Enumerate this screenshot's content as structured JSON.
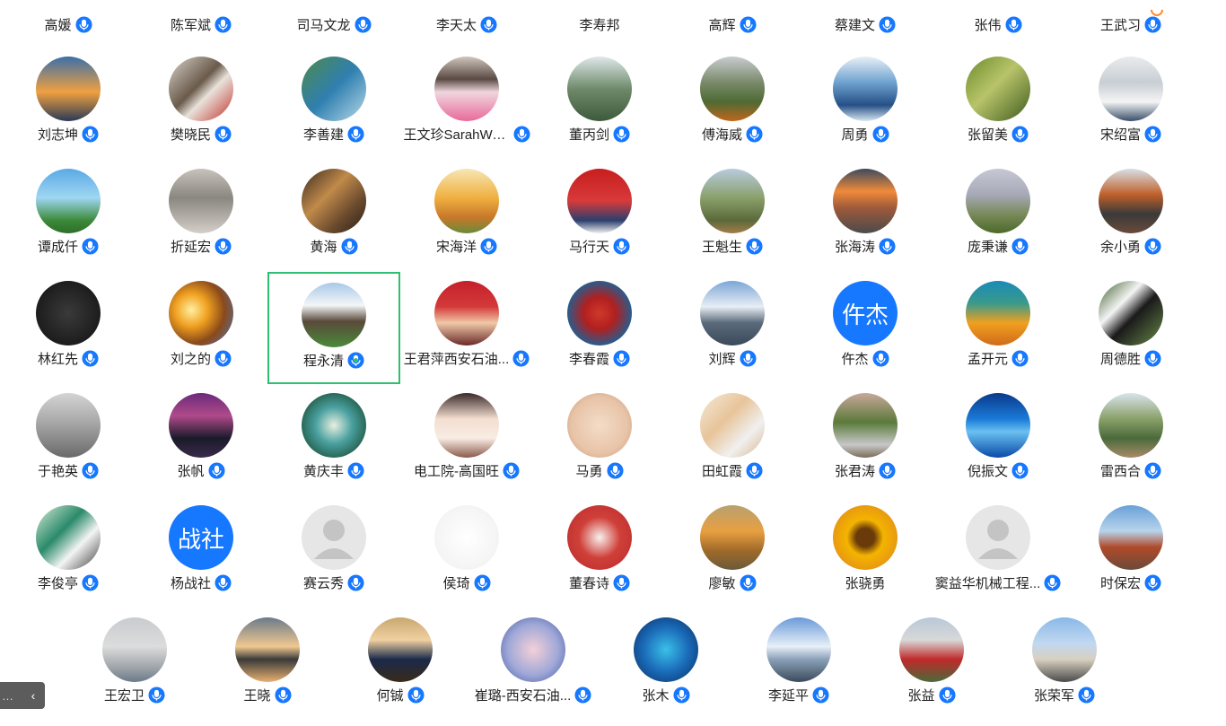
{
  "rows": [
    {
      "kind": "top",
      "participants": [
        {
          "name": "高媛",
          "mic": "on",
          "avatar": {
            "type": "none"
          }
        },
        {
          "name": "陈军斌",
          "mic": "on",
          "avatar": {
            "type": "none"
          }
        },
        {
          "name": "司马文龙",
          "mic": "on",
          "avatar": {
            "type": "none"
          }
        },
        {
          "name": "李天太",
          "mic": "on",
          "avatar": {
            "type": "none"
          }
        },
        {
          "name": "李寿邦",
          "mic": "none",
          "avatar": {
            "type": "none"
          }
        },
        {
          "name": "高辉",
          "mic": "on",
          "avatar": {
            "type": "none"
          }
        },
        {
          "name": "蔡建文",
          "mic": "on",
          "avatar": {
            "type": "none"
          }
        },
        {
          "name": "张伟",
          "mic": "on",
          "avatar": {
            "type": "none"
          }
        },
        {
          "name": "王武习",
          "mic": "on",
          "avatar": {
            "type": "none"
          }
        }
      ]
    },
    {
      "kind": "full",
      "participants": [
        {
          "name": "刘志坤",
          "mic": "on",
          "avatar": {
            "type": "photo",
            "bg": "linear-gradient(180deg,#3b6fa8 0%,#f0a040 55%,#2a3a55 100%)",
            "icon": "sunset-bridge-photo"
          }
        },
        {
          "name": "樊晓民",
          "mic": "on",
          "avatar": {
            "type": "photo",
            "bg": "linear-gradient(135deg,#d9d4cc 0%,#6a5a4a 45%,#e8e2da 60%,#c0302a 100%)",
            "icon": "eagle-photo"
          }
        },
        {
          "name": "李善建",
          "mic": "on",
          "avatar": {
            "type": "photo",
            "bg": "linear-gradient(135deg,#4d8a4a 0%,#2f7fb0 50%,#b9d9e8 100%)",
            "icon": "coastline-photo"
          }
        },
        {
          "name": "王文珍SarahWe...",
          "mic": "on",
          "avatar": {
            "type": "photo",
            "bg": "linear-gradient(180deg,#cfc6bd 0%,#5a4a44 35%,#f0d6de 55%,#e86a9a 100%)",
            "icon": "woman-with-flowers-photo"
          }
        },
        {
          "name": "董丙剑",
          "mic": "on",
          "avatar": {
            "type": "photo",
            "bg": "linear-gradient(180deg,#dfe8ea 0%,#6e8a6a 50%,#3e5a3c 100%)",
            "icon": "mountain-pine-photo"
          }
        },
        {
          "name": "傅海威",
          "mic": "on",
          "avatar": {
            "type": "photo",
            "bg": "linear-gradient(180deg,#c8ccd0 0%,#7a8a6a 40%,#4e6a34 70%,#c0661c 100%)",
            "icon": "orchard-photo"
          }
        },
        {
          "name": "周勇",
          "mic": "on",
          "avatar": {
            "type": "photo",
            "bg": "linear-gradient(180deg,#e8f0f6 0%,#6fa2d0 40%,#254f86 75%,#d8e6f0 100%)",
            "icon": "ferris-wheel-photo"
          }
        },
        {
          "name": "张留美",
          "mic": "on",
          "avatar": {
            "type": "photo",
            "bg": "linear-gradient(135deg,#6b8a2a 0%,#b8c46a 45%,#3f5a1e 100%)",
            "icon": "bamboo-photo"
          }
        },
        {
          "name": "宋绍富",
          "mic": "on",
          "avatar": {
            "type": "photo",
            "bg": "linear-gradient(180deg,#e9ecee 0%,#c8ced4 40%,#f4f4f4 70%,#3a4e6a 100%)",
            "icon": "man-portrait-photo"
          }
        }
      ]
    },
    {
      "kind": "full",
      "participants": [
        {
          "name": "谭成仟",
          "mic": "on",
          "avatar": {
            "type": "photo",
            "bg": "linear-gradient(180deg,#5aa9e6 0%,#9fd6f2 45%,#3c8a3a 80%,#2e6e2a 100%)",
            "icon": "palm-trees-photo"
          }
        },
        {
          "name": "折延宏",
          "mic": "on",
          "avatar": {
            "type": "photo",
            "bg": "linear-gradient(180deg,#c7c2bc 0%,#8a8680 45%,#d4cfc8 100%)",
            "icon": "tree-house-photo"
          }
        },
        {
          "name": "黄海",
          "mic": "on",
          "avatar": {
            "type": "photo",
            "bg": "linear-gradient(135deg,#3a2a1e 0%,#c08a4a 40%,#6a4a2e 70%,#2a1e14 100%)",
            "icon": "desert-photo"
          }
        },
        {
          "name": "宋海洋",
          "mic": "on",
          "avatar": {
            "type": "photo",
            "bg": "linear-gradient(180deg,#f6e6b4 0%,#f0b040 45%,#c8782a 75%,#6a8a3a 100%)",
            "icon": "autumn-tree-photo"
          }
        },
        {
          "name": "马行天",
          "mic": "on",
          "avatar": {
            "type": "photo",
            "bg": "linear-gradient(180deg,#c81e1e 0%,#d83a3a 50%,#2a3f6e 80%,#f0f0f0 100%)",
            "icon": "man-red-background-photo"
          }
        },
        {
          "name": "王魁生",
          "mic": "on",
          "avatar": {
            "type": "photo",
            "bg": "linear-gradient(180deg,#b8cbe0 0%,#8aa06a 45%,#5a6a3a 80%,#a67c4a 100%)",
            "icon": "hills-photo"
          }
        },
        {
          "name": "张海涛",
          "mic": "on",
          "avatar": {
            "type": "photo",
            "bg": "linear-gradient(180deg,#3c4a5e 0%,#f08a3a 35%,#a05a3a 60%,#4a4a4a 100%)",
            "icon": "sunset-street-photo"
          }
        },
        {
          "name": "庞秉谦",
          "mic": "on",
          "avatar": {
            "type": "photo",
            "bg": "linear-gradient(180deg,#c6c8d4 0%,#a7a9b8 40%,#7a8a5a 70%,#4c6a2a 100%)",
            "icon": "rainbow-field-photo"
          }
        },
        {
          "name": "余小勇",
          "mic": "on",
          "avatar": {
            "type": "photo",
            "bg": "linear-gradient(180deg,#d8e0e6 0%,#c0602a 40%,#3a3a3a 70%,#6a4a3a 100%)",
            "icon": "man-autumn-photo"
          }
        }
      ]
    },
    {
      "kind": "full",
      "participants": [
        {
          "name": "林红先",
          "mic": "on",
          "avatar": {
            "type": "photo",
            "bg": "radial-gradient(circle,#3a3a3a 0%,#101010 100%)",
            "icon": "calligraphy-jiayou-photo"
          }
        },
        {
          "name": "刘之的",
          "mic": "on",
          "avatar": {
            "type": "photo",
            "bg": "radial-gradient(circle at 35% 45%,#fff0a0 0%,#f0a020 30%,#8a4a1a 60%,#4a7ac8 100%)",
            "icon": "cosmic-explosion-photo"
          }
        },
        {
          "name": "程永清",
          "mic": "speaking",
          "speaking": true,
          "avatar": {
            "type": "photo",
            "bg": "linear-gradient(180deg,#a9c8e8 0%,#f4f6f8 35%,#5a4a3a 60%,#4a8a3a 100%)",
            "icon": "cattle-field-photo"
          }
        },
        {
          "name": "王君萍西安石油...",
          "mic": "on",
          "avatar": {
            "type": "photo",
            "bg": "linear-gradient(180deg,#c4202a 0%,#d43a3a 40%,#f0c8a8 65%,#6a2a2a 100%)",
            "icon": "woman-portrait-photo"
          }
        },
        {
          "name": "李春霞",
          "mic": "on",
          "avatar": {
            "type": "photo",
            "bg": "radial-gradient(circle,#d0392a 0%,#b02020 35%,#2c5a8a 70%,#1a3a6a 100%)",
            "icon": "party-emblem-photo"
          }
        },
        {
          "name": "刘辉",
          "mic": "on",
          "avatar": {
            "type": "photo",
            "bg": "linear-gradient(180deg,#7aa6d6 0%,#e8eef4 40%,#5a6a7a 65%,#3a4a5a 100%)",
            "icon": "mountain-valley-photo"
          }
        },
        {
          "name": "仵杰",
          "mic": "on",
          "avatar": {
            "type": "text",
            "text": "仵杰",
            "color": "#1677ff"
          }
        },
        {
          "name": "孟开元",
          "mic": "on",
          "avatar": {
            "type": "photo",
            "bg": "linear-gradient(180deg,#1a8ab8 0%,#3a9a8a 35%,#f0a020 65%,#d06a1a 100%)",
            "icon": "lake-autumn-photo"
          }
        },
        {
          "name": "周德胜",
          "mic": "on",
          "avatar": {
            "type": "photo",
            "bg": "linear-gradient(135deg,#3a5a2a 0%,#f4f4f4 35%,#1a1a1a 55%,#6a8a4a 100%)",
            "icon": "panda-photo"
          }
        }
      ]
    },
    {
      "kind": "full",
      "participants": [
        {
          "name": "于艳英",
          "mic": "on",
          "avatar": {
            "type": "photo",
            "bg": "linear-gradient(180deg,#d4d4d4 0%,#a8a8a8 45%,#6a6a6a 100%)",
            "icon": "woman-bw-photo"
          }
        },
        {
          "name": "张帆",
          "mic": "on",
          "avatar": {
            "type": "photo",
            "bg": "linear-gradient(180deg,#6a2a7a 0%,#b04a8a 35%,#1a1a2a 70%,#3a2a4a 100%)",
            "icon": "stage-performance-photo"
          }
        },
        {
          "name": "黄庆丰",
          "mic": "on",
          "avatar": {
            "type": "photo",
            "bg": "radial-gradient(circle,#e8f0e0 0%,#4aa0a0 40%,#2a6a5a 70%,#1a3a3a 100%)",
            "icon": "illustrated-face-photo"
          }
        },
        {
          "name": "电工院-高国旺",
          "mic": "on",
          "avatar": {
            "type": "photo",
            "bg": "linear-gradient(180deg,#3a2a2a 0%,#f4ded0 40%,#f8ece4 70%,#8a5a4a 100%)",
            "icon": "anime-girl-photo"
          }
        },
        {
          "name": "马勇",
          "mic": "on",
          "avatar": {
            "type": "photo",
            "bg": "radial-gradient(circle,#f4dcc8 0%,#e8c4a8 60%,#c89a7a 100%)",
            "icon": "cartoon-cat-photo"
          }
        },
        {
          "name": "田虹霞",
          "mic": "on",
          "avatar": {
            "type": "photo",
            "bg": "linear-gradient(135deg,#f4ead8 0%,#e8c49a 40%,#f0f0f0 70%,#d8b48a 100%)",
            "icon": "woman-photo"
          }
        },
        {
          "name": "张君涛",
          "mic": "on",
          "avatar": {
            "type": "photo",
            "bg": "linear-gradient(180deg,#c8a89a 0%,#5a7a3a 45%,#c8c8c8 80%,#7a6a5a 100%)",
            "icon": "two-people-park-photo"
          }
        },
        {
          "name": "倪振文",
          "mic": "on",
          "avatar": {
            "type": "photo",
            "bg": "linear-gradient(180deg,#0a3a8a 0%,#1a7ad8 40%,#6ac0f0 60%,#0a4aa8 100%)",
            "icon": "blue-ocean-photo"
          }
        },
        {
          "name": "雷西合",
          "mic": "on",
          "avatar": {
            "type": "photo",
            "bg": "linear-gradient(180deg,#d8e4ec 0%,#8aa06a 40%,#4a6a3a 70%,#a88a6a 100%)",
            "icon": "rock-garden-photo"
          }
        }
      ]
    },
    {
      "kind": "full",
      "participants": [
        {
          "name": "李俊亭",
          "mic": "on",
          "avatar": {
            "type": "photo",
            "bg": "linear-gradient(135deg,#d8ecd8 0%,#2a8a6a 40%,#f4f4f4 65%,#3a3a3a 100%)",
            "icon": "man-speaking-photo"
          }
        },
        {
          "name": "杨战社",
          "mic": "on",
          "avatar": {
            "type": "text",
            "text": "战社",
            "color": "#1677ff"
          }
        },
        {
          "name": "赛云秀",
          "mic": "on",
          "avatar": {
            "type": "default"
          }
        },
        {
          "name": "侯琦",
          "mic": "on",
          "avatar": {
            "type": "photo",
            "bg": "radial-gradient(circle,#ffffff 0%,#f4f4f4 70%,#e4e4e4 100%)",
            "icon": "calligraphy-scroll-photo"
          }
        },
        {
          "name": "董春诗",
          "mic": "on",
          "avatar": {
            "type": "photo",
            "bg": "radial-gradient(circle,#f8f0ec 0%,#d0403a 45%,#b82a2a 100%)",
            "icon": "red-seal-photo"
          }
        },
        {
          "name": "廖敏",
          "mic": "on",
          "avatar": {
            "type": "photo",
            "bg": "linear-gradient(180deg,#b8a070 0%,#e8a040 40%,#a06a2a 70%,#6a5a3a 100%)",
            "icon": "autumn-path-photo"
          }
        },
        {
          "name": "张骁勇",
          "mic": "none",
          "avatar": {
            "type": "photo",
            "bg": "radial-gradient(circle,#6a3a0a 0%,#6a3a0a 20%,#f4b400 40%,#e89a10 70%,#5a8a3a 100%)",
            "icon": "sunflower-photo"
          }
        },
        {
          "name": "窦益华机械工程...",
          "mic": "on",
          "avatar": {
            "type": "default"
          }
        },
        {
          "name": "时保宏",
          "mic": "on",
          "avatar": {
            "type": "photo",
            "bg": "linear-gradient(180deg,#6aa0d8 0%,#b8d4ec 40%,#b04a2a 65%,#6a4a3a 100%)",
            "icon": "campus-buildings-photo"
          }
        }
      ]
    },
    {
      "kind": "last",
      "participants": [
        {
          "name": "王宏卫",
          "mic": "on",
          "avatar": {
            "type": "photo",
            "bg": "linear-gradient(180deg,#c8ccd0 0%,#dcdcdc 45%,#9aa0a6 80%,#6a7a8a 100%)",
            "icon": "rainbow-city-photo"
          }
        },
        {
          "name": "王晓",
          "mic": "on",
          "avatar": {
            "type": "photo",
            "bg": "linear-gradient(180deg,#6a7a8a 0%,#f0c890 45%,#3a3a3a 65%,#e8b070 100%)",
            "icon": "lake-sunset-photo"
          }
        },
        {
          "name": "何铖",
          "mic": "on",
          "avatar": {
            "type": "photo",
            "bg": "linear-gradient(180deg,#c8a870 0%,#f0d0a0 35%,#1a2a4a 65%,#3a2a1a 100%)",
            "icon": "man-suit-photo"
          }
        },
        {
          "name": "崔璐-西安石油...",
          "mic": "on",
          "avatar": {
            "type": "photo",
            "bg": "radial-gradient(circle,#f4d0d8 0%,#a0a8d8 55%,#6a7ab8 80%,#c8a0b8 100%)",
            "icon": "window-illustration-photo"
          }
        },
        {
          "name": "张木",
          "mic": "on",
          "avatar": {
            "type": "photo",
            "bg": "radial-gradient(circle,#3ac0e8 0%,#1a6ab8 50%,#0a2a5a 100%)",
            "icon": "diver-photo"
          }
        },
        {
          "name": "李延平",
          "mic": "on",
          "avatar": {
            "type": "photo",
            "bg": "linear-gradient(180deg,#6a9ad8 0%,#e8f0f8 45%,#8aa0b8 65%,#3a4a5a 100%)",
            "icon": "sea-of-clouds-photo"
          }
        },
        {
          "name": "张益",
          "mic": "on",
          "avatar": {
            "type": "photo",
            "bg": "linear-gradient(180deg,#b8c8d8 0%,#d8d8d8 35%,#c02a2a 65%,#4a6a3a 100%)",
            "icon": "red-flowers-photo"
          }
        },
        {
          "name": "张荣军",
          "mic": "on",
          "avatar": {
            "type": "photo",
            "bg": "linear-gradient(180deg,#8ab8e8 0%,#c0d8f0 40%,#d8d0c0 65%,#4a4a4a 100%)",
            "icon": "palace-photo"
          }
        }
      ]
    }
  ],
  "footer": {
    "truncated_label": "…",
    "chevron": "‹"
  },
  "colors": {
    "mic_blue": "#1677ff",
    "speaking_green": "#2fbf71",
    "badge_orange": "#ff8a2b"
  }
}
